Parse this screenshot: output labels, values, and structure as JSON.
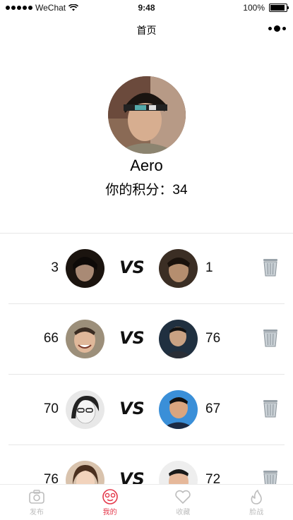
{
  "status_bar": {
    "carrier": "WeChat",
    "time": "9:48",
    "battery_label": "100%",
    "battery_level": 1.0
  },
  "nav": {
    "title": "首页"
  },
  "profile": {
    "name": "Aero",
    "score_label": "你的积分：34"
  },
  "vs_label": "VS",
  "matches": [
    {
      "left_score": "3",
      "right_score": "1"
    },
    {
      "left_score": "66",
      "right_score": "76"
    },
    {
      "left_score": "70",
      "right_score": "67"
    },
    {
      "left_score": "76",
      "right_score": "72"
    }
  ],
  "tabs": [
    {
      "label": "发布",
      "icon": "camera-icon",
      "active": false
    },
    {
      "label": "我的",
      "icon": "monkey-face-icon",
      "active": true
    },
    {
      "label": "收藏",
      "icon": "heart-icon",
      "active": false
    },
    {
      "label": "脸战",
      "icon": "flame-icon",
      "active": false
    }
  ],
  "colors": {
    "accent": "#e4394b",
    "tab_inactive": "#bdbdbd",
    "divider": "#e6e6e6"
  }
}
